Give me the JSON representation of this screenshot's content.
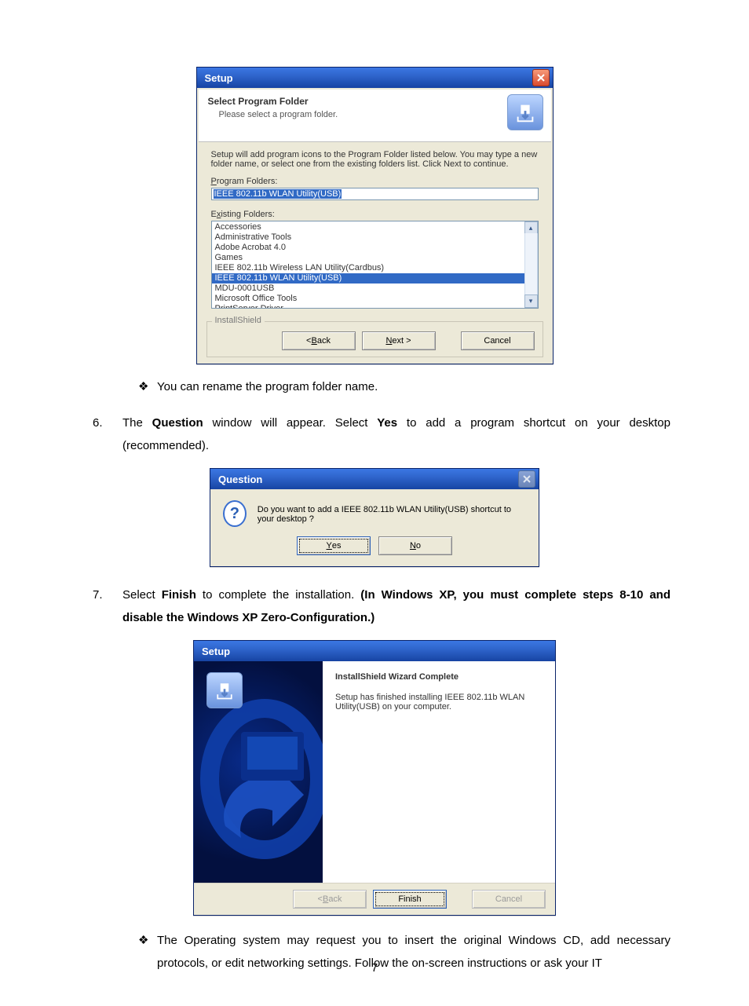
{
  "setup1": {
    "title": "Setup",
    "stepTitle": "Select Program Folder",
    "stepSubtitle": "Please select a program folder.",
    "instruction": "Setup will add program icons to the Program Folder listed below.  You may type a new folder name, or select one from the existing folders list.  Click Next to continue.",
    "programFoldersLabel": "Program Folders:",
    "programFoldersValue": "IEEE 802.11b WLAN Utility(USB)",
    "existingFoldersLabel": "Existing Folders:",
    "folders": [
      "Accessories",
      "Administrative Tools",
      "Adobe Acrobat 4.0",
      "Games",
      "IEEE 802.11b Wireless LAN Utility(Cardbus)",
      "IEEE 802.11b WLAN Utility(USB)",
      "MDU-0001USB",
      "Microsoft Office Tools",
      "PrintServer Driver"
    ],
    "selectedIndex": 5,
    "installShield": "InstallShield",
    "back": "< Back",
    "next": "Next >",
    "cancel": "Cancel"
  },
  "bullet1": "You can rename the program folder name.",
  "item6": {
    "num": "6.",
    "pre": "The ",
    "boldQuestion": "Question",
    "mid": " window will appear. Select ",
    "boldYes": "Yes",
    "post": " to add a program shortcut on your desktop (recommended)."
  },
  "question": {
    "title": "Question",
    "text": "Do you want to add a IEEE 802.11b WLAN Utility(USB) shortcut to your desktop ?",
    "yes": "Yes",
    "no": "No"
  },
  "item7": {
    "num": "7.",
    "pre": "Select ",
    "boldFinish": "Finish",
    "mid": " to complete the installation. ",
    "boldTail": "(In Windows XP, you must complete steps 8-10 and disable the Windows XP Zero-Configuration.)"
  },
  "setup2": {
    "title": "Setup",
    "heading": "InstallShield Wizard Complete",
    "text": "Setup has finished installing IEEE 802.11b WLAN Utility(USB) on your computer.",
    "back": "< Back",
    "finish": "Finish",
    "cancel": "Cancel"
  },
  "bullet2": "The Operating system may request you to insert the original Windows CD, add necessary protocols, or edit networking settings. Follow the on-screen instructions or ask your IT",
  "pageNumber": "7"
}
